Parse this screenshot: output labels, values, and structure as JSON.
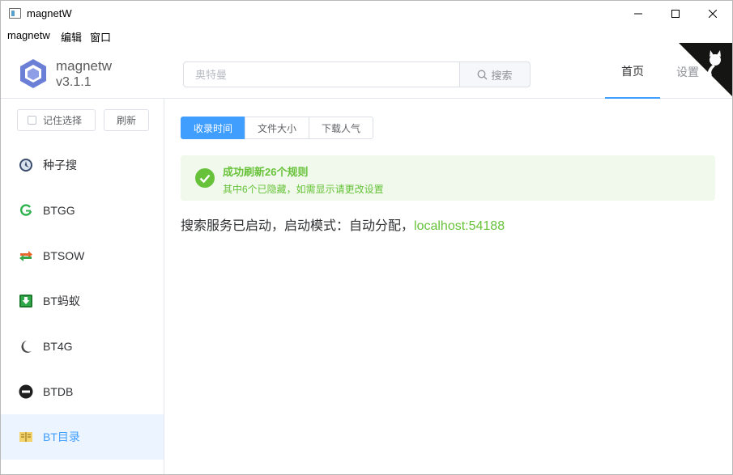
{
  "window": {
    "title": "magnetW"
  },
  "menu": {
    "items": [
      "magnetw",
      "编辑",
      "窗口"
    ]
  },
  "brand": {
    "name": "magnetw",
    "version": "v3.1.1"
  },
  "search": {
    "placeholder": "奥特曼",
    "button_label": "搜索"
  },
  "nav": {
    "home": "首页",
    "settings": "设置"
  },
  "sidebar": {
    "remember_label": "记住选择",
    "refresh_label": "刷新",
    "sites": [
      {
        "label": "种子搜",
        "icon": "compass-icon"
      },
      {
        "label": "BTGG",
        "icon": "btgg-logo-icon"
      },
      {
        "label": "BTSOW",
        "icon": "arrows-swap-icon"
      },
      {
        "label": "BT蚂蚁",
        "icon": "download-box-icon"
      },
      {
        "label": "BT4G",
        "icon": "crescent-icon"
      },
      {
        "label": "BTDB",
        "icon": "btdb-badge-icon"
      },
      {
        "label": "BT目录",
        "icon": "book-icon",
        "active": true
      }
    ]
  },
  "sort": {
    "options": [
      "收录时间",
      "文件大小",
      "下载人气"
    ],
    "selected": "收录时间"
  },
  "alert": {
    "title": "成功刷新26个规则",
    "description": "其中6个已隐藏，如需显示请更改设置"
  },
  "status": {
    "text": "搜索服务已启动，启动模式：自动分配，",
    "address": "localhost:54188"
  },
  "colors": {
    "accent": "#409eff",
    "success": "#67c23a",
    "success_bg": "#f0f9eb",
    "logo": "#6b7fd7"
  }
}
